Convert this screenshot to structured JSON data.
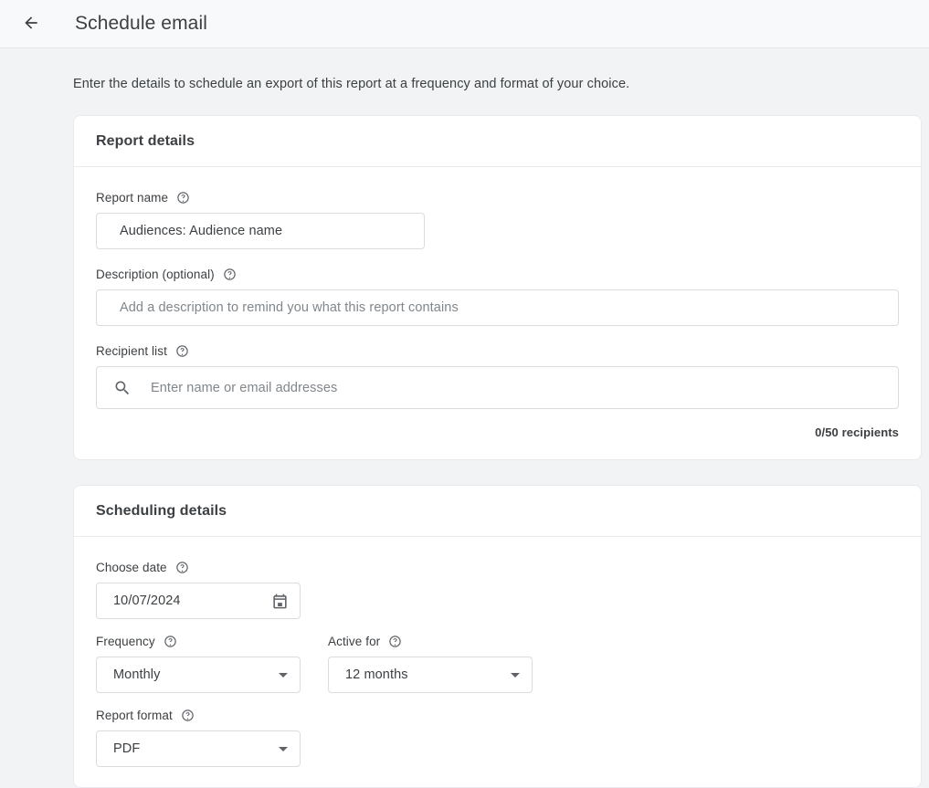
{
  "header": {
    "back_icon": "arrow-left-icon",
    "title": "Schedule email"
  },
  "intro": "Enter the details to schedule an export of this report at a frequency and format of your choice.",
  "report_details": {
    "card_title": "Report details",
    "report_name": {
      "label": "Report name",
      "help_icon": "help-circle-icon",
      "value": "Audiences: Audience name"
    },
    "description": {
      "label": "Description (optional)",
      "help_icon": "help-circle-icon",
      "placeholder": "Add a description to remind you what this report contains"
    },
    "recipient_list": {
      "label": "Recipient list",
      "help_icon": "help-circle-icon",
      "search_icon": "search-icon",
      "placeholder": "Enter name or email addresses",
      "counter": "0/50 recipients"
    }
  },
  "scheduling_details": {
    "card_title": "Scheduling details",
    "choose_date": {
      "label": "Choose date",
      "help_icon": "help-circle-icon",
      "value": "10/07/2024",
      "calendar_icon": "calendar-icon"
    },
    "frequency": {
      "label": "Frequency",
      "help_icon": "help-circle-icon",
      "value": "Monthly",
      "caret_icon": "chevron-down-icon"
    },
    "active_for": {
      "label": "Active for",
      "help_icon": "help-circle-icon",
      "value": "12 months",
      "caret_icon": "chevron-down-icon"
    },
    "report_format": {
      "label": "Report format",
      "help_icon": "help-circle-icon",
      "value": "PDF",
      "caret_icon": "chevron-down-icon"
    }
  },
  "colors": {
    "page_background": "#f1f3f4",
    "header_background": "#f8f9fa",
    "card_background": "#ffffff",
    "border": "#dadce0",
    "text_primary": "#3c4043",
    "text_placeholder": "#80868b"
  }
}
